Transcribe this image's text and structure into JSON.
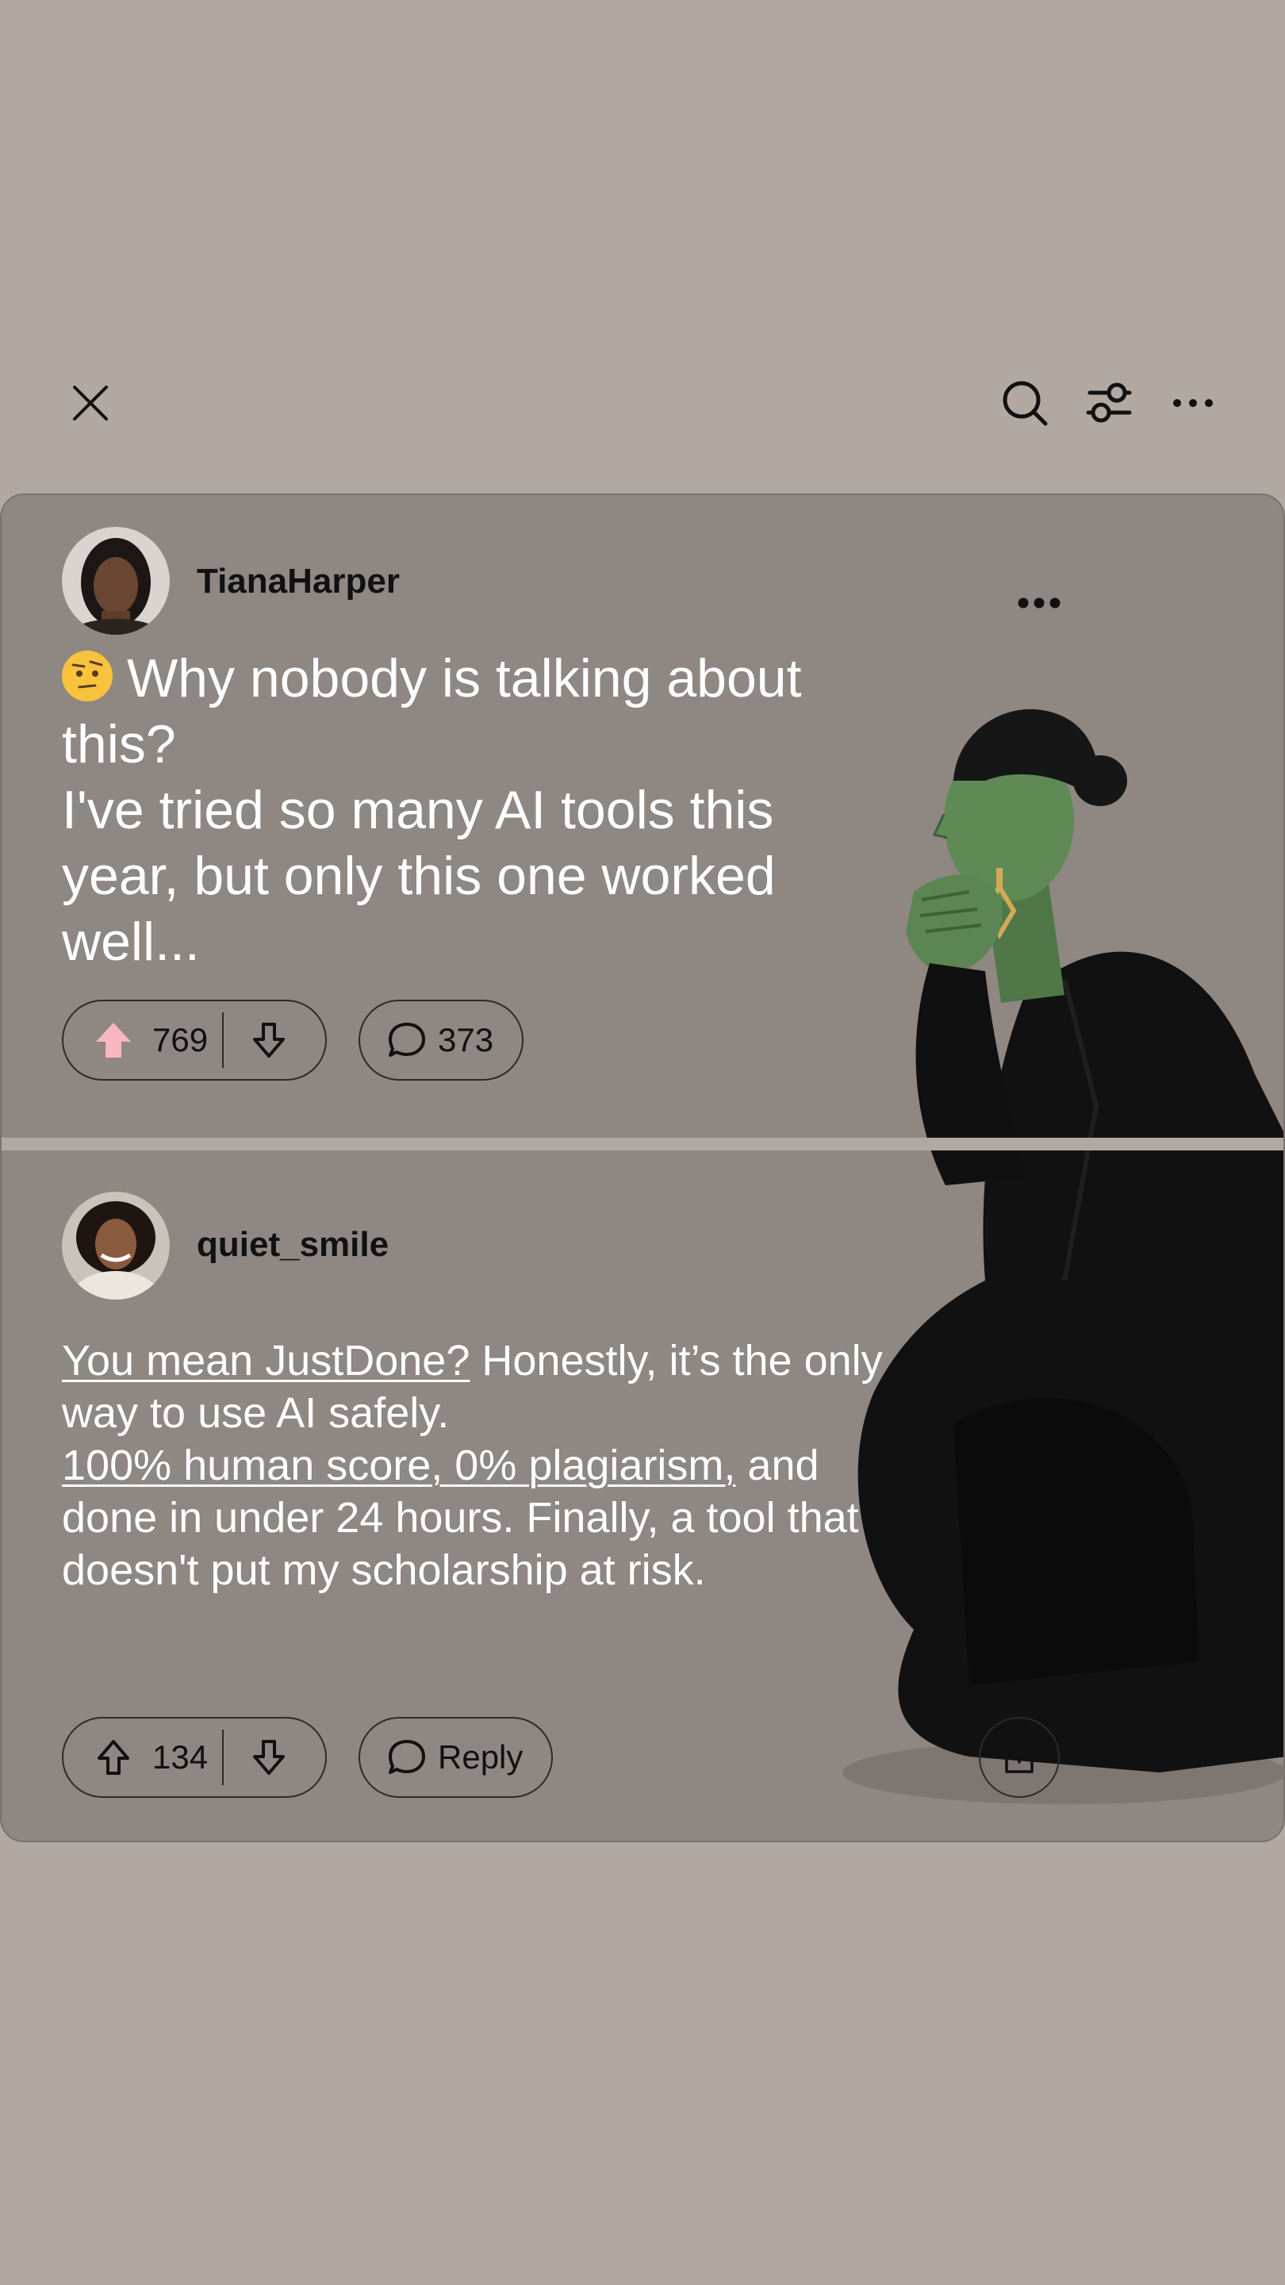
{
  "topbar": {
    "close_icon": "close-icon",
    "search_icon": "search-icon",
    "filter_icon": "filter-icon",
    "more_icon": "more-horizontal-icon"
  },
  "post": {
    "author": "TianaHarper",
    "emoji": "🤨",
    "title_line1": "Why nobody is talking about this?",
    "title_line2": "I've tried so many AI tools this year, but only this one worked well...",
    "upvotes": "769",
    "comments": "373",
    "upvote_active_color": "#f8b7bf"
  },
  "comment": {
    "author": "quiet_smile",
    "link1": "You mean JustDone?",
    "text1": " Honestly, it’s the only way to use AI safely.",
    "link2": "100% human score, 0% plagiarism,",
    "text2": " and done in under 24 hours. Finally, a tool that doesn't put my scholarship at risk.",
    "upvotes": "134",
    "reply_label": "Reply"
  },
  "colors": {
    "background": "#b1a9a1",
    "card": "#8f8782",
    "skin_green": "#5f8a56"
  }
}
